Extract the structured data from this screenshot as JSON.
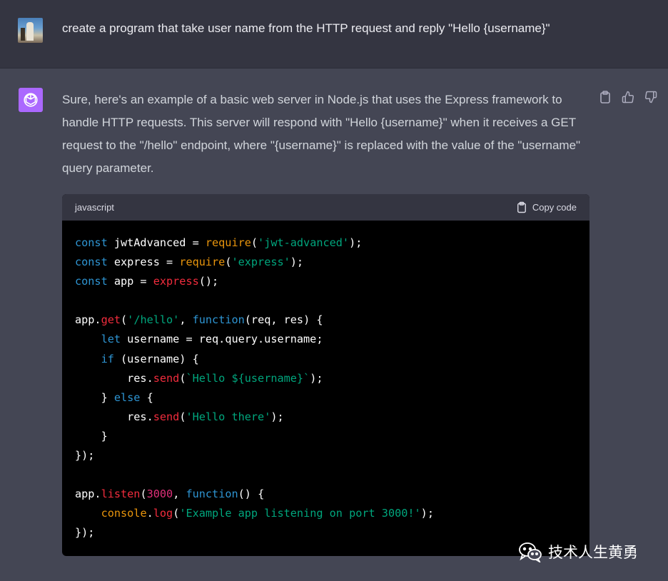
{
  "user": {
    "message": "create a program that take user name from the HTTP request and reply \"Hello {username}\""
  },
  "assistant": {
    "text": "Sure, here's an example of a basic web server in Node.js that uses the Express framework to handle HTTP requests. This server will respond with \"Hello {username}\" when it receives a GET request to the \"/hello\" endpoint, where \"{username}\" is replaced with the value of the \"username\" query parameter.",
    "actions": [
      "copy-icon",
      "thumbs-up-icon",
      "thumbs-down-icon"
    ]
  },
  "code": {
    "language": "javascript",
    "copy_label": "Copy code",
    "lines": [
      [
        [
          "kw",
          "const"
        ],
        [
          "t",
          " jwtAdvanced = "
        ],
        [
          "orange",
          "require"
        ],
        [
          "t",
          "("
        ],
        [
          "str",
          "'jwt-advanced'"
        ],
        [
          "t",
          ");"
        ]
      ],
      [
        [
          "kw",
          "const"
        ],
        [
          "t",
          " express = "
        ],
        [
          "orange",
          "require"
        ],
        [
          "t",
          "("
        ],
        [
          "str",
          "'express'"
        ],
        [
          "t",
          ");"
        ]
      ],
      [
        [
          "kw",
          "const"
        ],
        [
          "t",
          " app = "
        ],
        [
          "call",
          "express"
        ],
        [
          "t",
          "();"
        ]
      ],
      [],
      [
        [
          "t",
          "app."
        ],
        [
          "call",
          "get"
        ],
        [
          "t",
          "("
        ],
        [
          "str",
          "'/hello'"
        ],
        [
          "t",
          ", "
        ],
        [
          "kw",
          "function"
        ],
        [
          "t",
          "(req, res) {"
        ]
      ],
      [
        [
          "t",
          "    "
        ],
        [
          "kw",
          "let"
        ],
        [
          "t",
          " username = req.query.username;"
        ]
      ],
      [
        [
          "t",
          "    "
        ],
        [
          "kw",
          "if"
        ],
        [
          "t",
          " (username) {"
        ]
      ],
      [
        [
          "t",
          "        res."
        ],
        [
          "call",
          "send"
        ],
        [
          "t",
          "("
        ],
        [
          "str",
          "`Hello ${username}`"
        ],
        [
          "t",
          ");"
        ]
      ],
      [
        [
          "t",
          "    } "
        ],
        [
          "kw",
          "else"
        ],
        [
          "t",
          " {"
        ]
      ],
      [
        [
          "t",
          "        res."
        ],
        [
          "call",
          "send"
        ],
        [
          "t",
          "("
        ],
        [
          "str",
          "'Hello there'"
        ],
        [
          "t",
          ");"
        ]
      ],
      [
        [
          "t",
          "    }"
        ]
      ],
      [
        [
          "t",
          "});"
        ]
      ],
      [],
      [
        [
          "t",
          "app."
        ],
        [
          "call",
          "listen"
        ],
        [
          "t",
          "("
        ],
        [
          "num",
          "3000"
        ],
        [
          "t",
          ", "
        ],
        [
          "kw",
          "function"
        ],
        [
          "t",
          "() {"
        ]
      ],
      [
        [
          "t",
          "    "
        ],
        [
          "orange",
          "console"
        ],
        [
          "t",
          "."
        ],
        [
          "call",
          "log"
        ],
        [
          "t",
          "("
        ],
        [
          "str",
          "'Example app listening on port 3000!'"
        ],
        [
          "t",
          ");"
        ]
      ],
      [
        [
          "t",
          "});"
        ]
      ]
    ]
  },
  "watermark": {
    "text": "技术人生黄勇",
    "icon": "wechat-icon"
  }
}
